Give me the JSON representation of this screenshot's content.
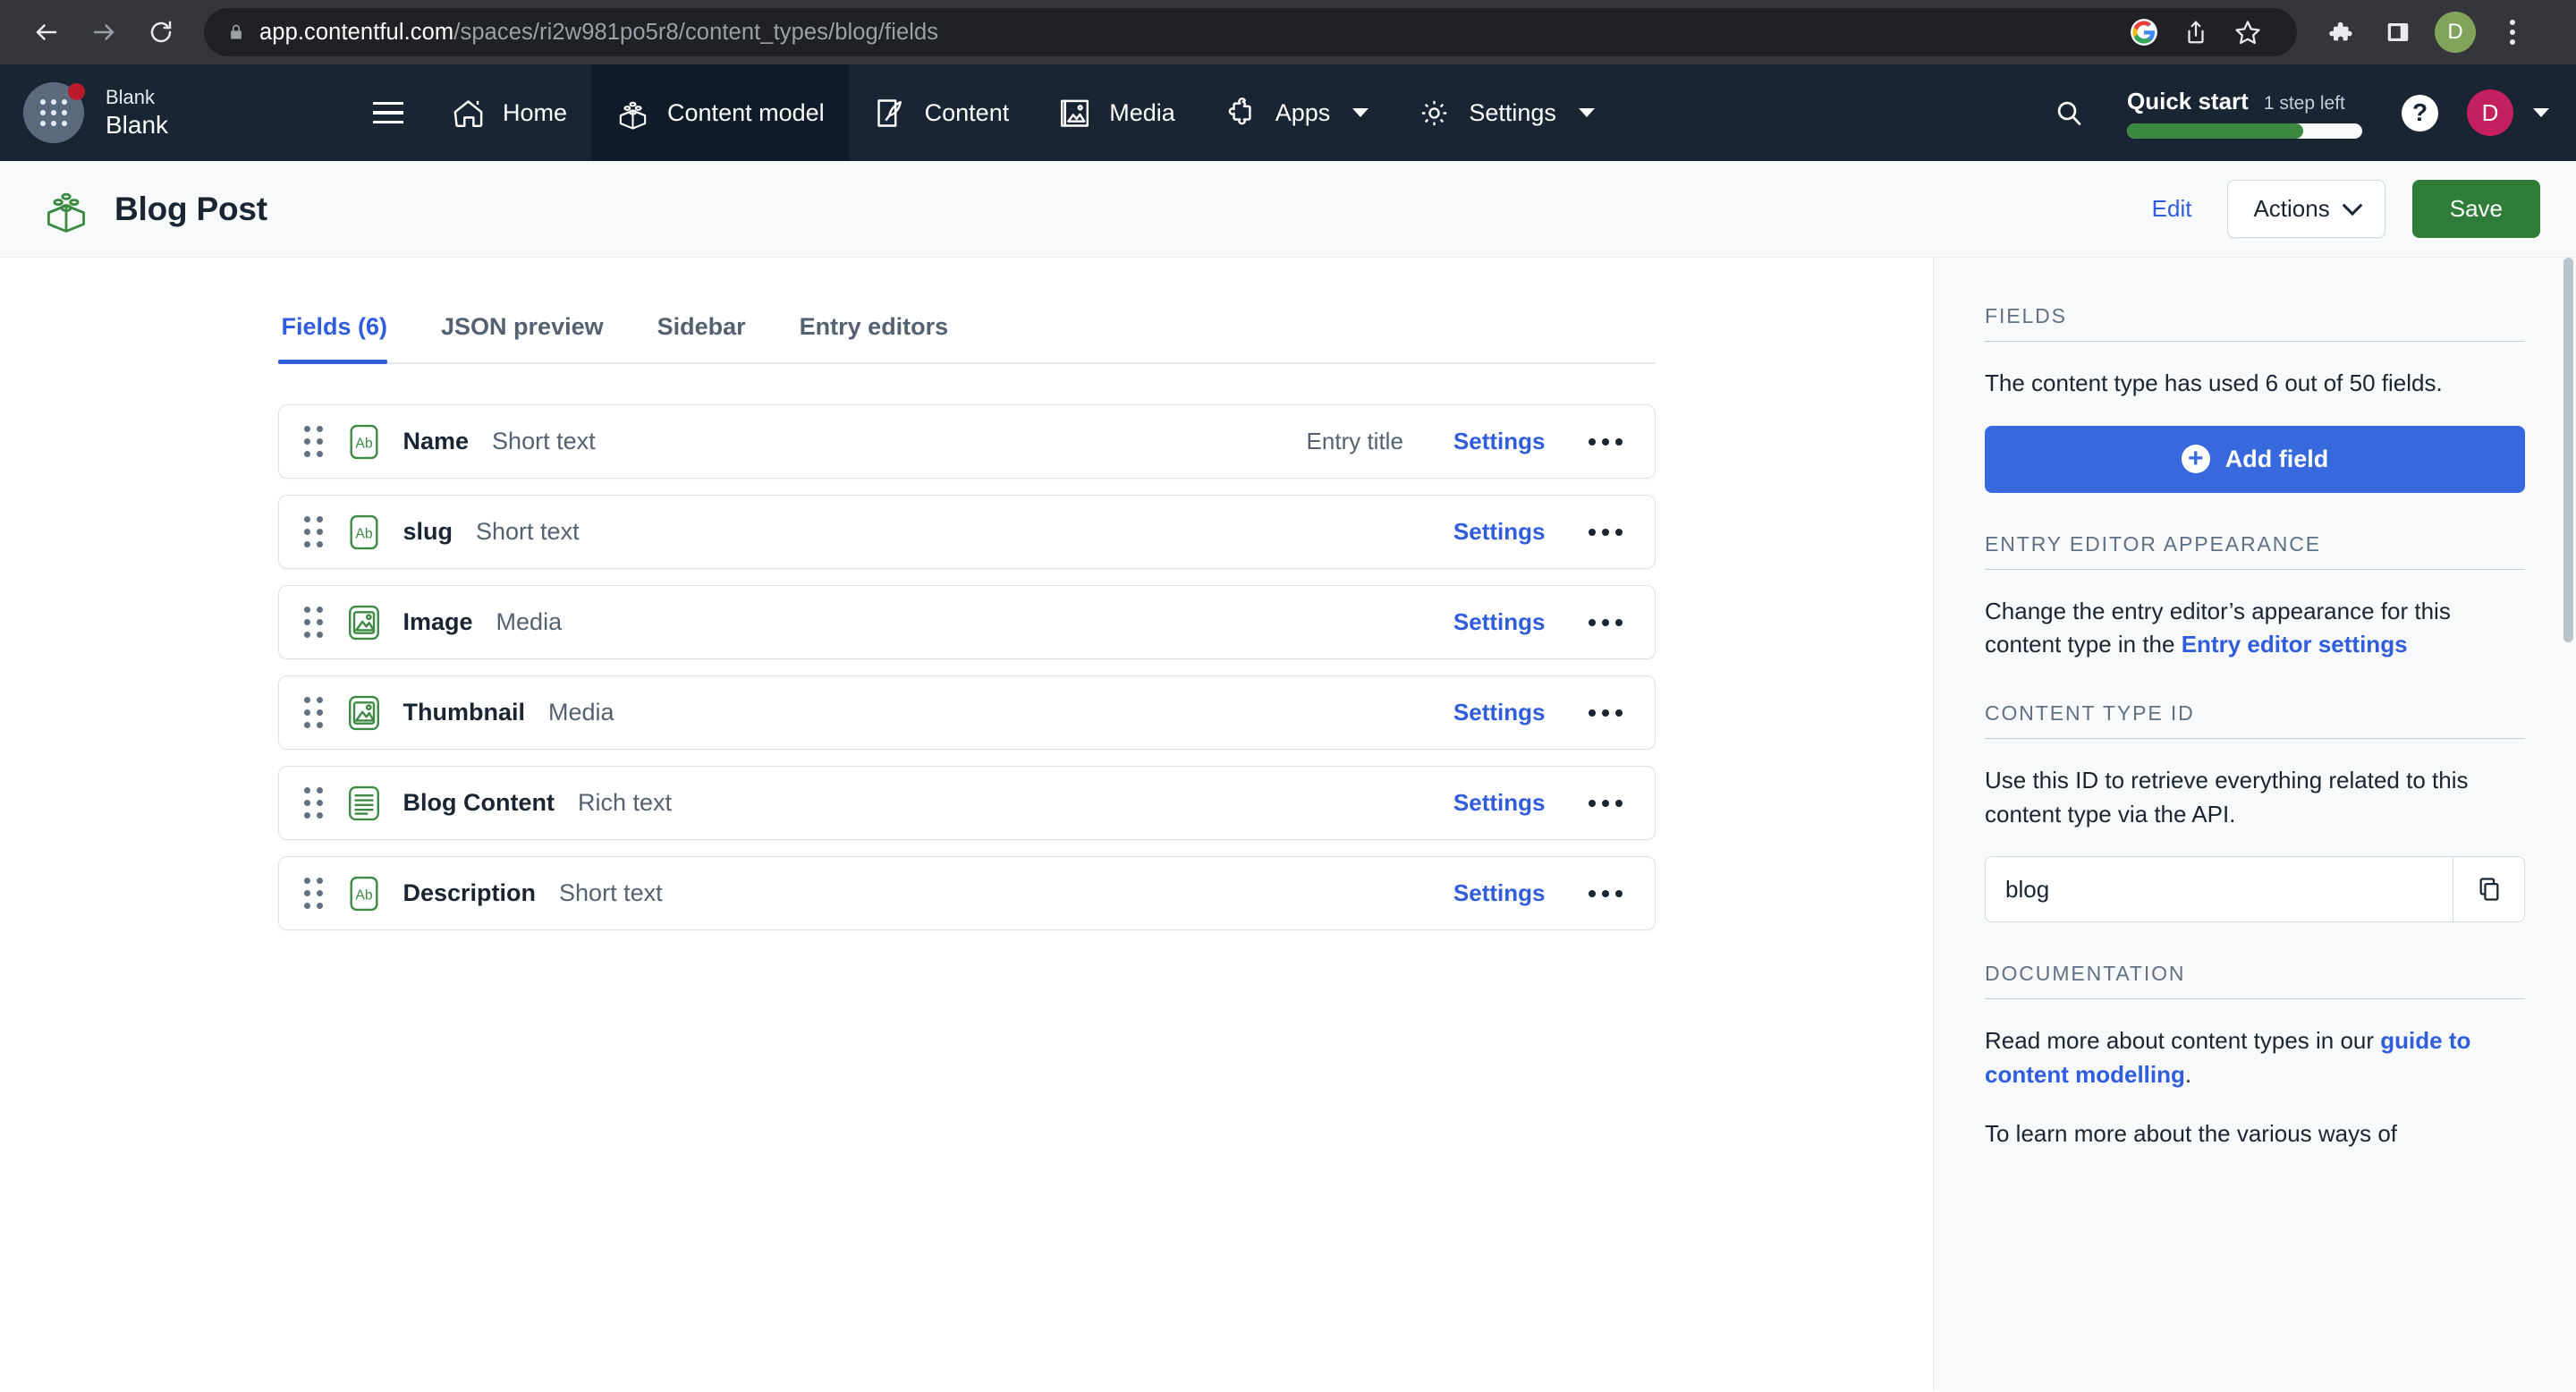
{
  "browser": {
    "back_icon": "back-arrow-icon",
    "forward_icon": "forward-arrow-icon",
    "reload_icon": "reload-icon",
    "lock_icon": "lock-icon",
    "url_host": "app.contentful.com",
    "url_path": "/spaces/ri2w981po5r8/content_types/blog/fields",
    "google_icon": "google-icon",
    "share_icon": "share-icon",
    "bookmark_icon": "star-icon",
    "extensions_icon": "puzzle-icon",
    "side_panel_icon": "side-panel-icon",
    "profile_initial": "D",
    "menu_icon": "kebab-menu-icon"
  },
  "app_nav": {
    "space_sub": "Blank",
    "space_title": "Blank",
    "menu_icon": "hamburger-icon",
    "items": [
      {
        "label": "Home",
        "icon": "home-icon",
        "active": false,
        "caret": false
      },
      {
        "label": "Content model",
        "icon": "content-model-icon",
        "active": true,
        "caret": false
      },
      {
        "label": "Content",
        "icon": "content-icon",
        "active": false,
        "caret": false
      },
      {
        "label": "Media",
        "icon": "media-icon",
        "active": false,
        "caret": false
      },
      {
        "label": "Apps",
        "icon": "apps-icon",
        "active": false,
        "caret": true
      },
      {
        "label": "Settings",
        "icon": "settings-gear-icon",
        "active": false,
        "caret": true
      }
    ],
    "search_icon": "search-icon",
    "quick_start": {
      "title": "Quick start",
      "steps_left": "1 step left",
      "progress_percent": 75,
      "progress_color": "#3c8a42"
    },
    "help_icon": "help-icon",
    "help_label": "?",
    "user_initial": "D",
    "user_avatar_color": "#c41f5e"
  },
  "page_header": {
    "icon": "content-type-lego-icon",
    "title": "Blog Post",
    "edit_label": "Edit",
    "actions_label": "Actions",
    "save_label": "Save",
    "save_color": "#2f7d38"
  },
  "tabs": [
    {
      "label": "Fields (6)",
      "active": true
    },
    {
      "label": "JSON preview",
      "active": false
    },
    {
      "label": "Sidebar",
      "active": false
    },
    {
      "label": "Entry editors",
      "active": false
    }
  ],
  "fields": [
    {
      "name": "Name",
      "type": "Short text",
      "icon": "short-text-icon",
      "tag": "Entry title",
      "settings_label": "Settings",
      "menu_icon": "more-options-icon"
    },
    {
      "name": "slug",
      "type": "Short text",
      "icon": "short-text-icon",
      "tag": "",
      "settings_label": "Settings",
      "menu_icon": "more-options-icon"
    },
    {
      "name": "Image",
      "type": "Media",
      "icon": "media-image-icon",
      "tag": "",
      "settings_label": "Settings",
      "menu_icon": "more-options-icon"
    },
    {
      "name": "Thumbnail",
      "type": "Media",
      "icon": "media-image-icon",
      "tag": "",
      "settings_label": "Settings",
      "menu_icon": "more-options-icon"
    },
    {
      "name": "Blog Content",
      "type": "Rich text",
      "icon": "rich-text-icon",
      "tag": "",
      "settings_label": "Settings",
      "menu_icon": "more-options-icon"
    },
    {
      "name": "Description",
      "type": "Short text",
      "icon": "short-text-icon",
      "tag": "",
      "settings_label": "Settings",
      "menu_icon": "more-options-icon"
    }
  ],
  "sidebar": {
    "fields_section": {
      "heading": "FIELDS",
      "description": "The content type has used 6 out of 50 fields.",
      "add_field_label": "Add field",
      "add_field_color": "#3868de"
    },
    "entry_editor_section": {
      "heading": "ENTRY EDITOR APPEARANCE",
      "description_before": "Change the entry editor’s appearance for this content type in the ",
      "link_label": "Entry editor settings"
    },
    "content_type_id_section": {
      "heading": "CONTENT TYPE ID",
      "description": "Use this ID to retrieve everything related to this content type via the API.",
      "id_value": "blog",
      "copy_icon": "copy-icon"
    },
    "documentation_section": {
      "heading": "DOCUMENTATION",
      "paragraph_before": "Read more about content types in our ",
      "link_label": "guide to content modelling",
      "paragraph_after": ".",
      "paragraph_two": "To learn more about the various ways of"
    }
  }
}
